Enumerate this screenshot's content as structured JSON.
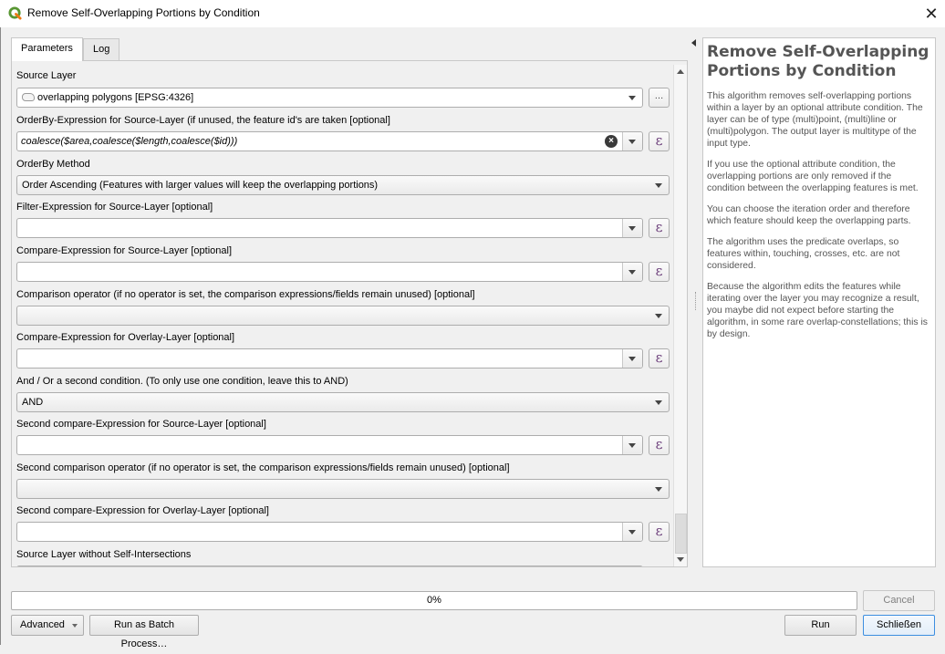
{
  "window": {
    "title": "Remove Self-Overlapping Portions by Condition",
    "close_glyph": "✕",
    "app_icon": "qgis-icon"
  },
  "tabs": [
    {
      "label": "Parameters",
      "active": true
    },
    {
      "label": "Log",
      "active": false
    }
  ],
  "parameters": {
    "source_layer": {
      "label": "Source Layer",
      "value": "overlapping polygons [EPSG:4326]",
      "icon": "polygon-layer-icon",
      "browse_label": "…"
    },
    "orderby_expression": {
      "label": "OrderBy-Expression for Source-Layer (if unused, the feature id's are taken [optional]",
      "value": "coalesce($area,coalesce($length,coalesce($id)))"
    },
    "orderby_method": {
      "label": "OrderBy Method",
      "value": "Order Ascending (Features with larger values will keep the overlapping portions)"
    },
    "filter_expression": {
      "label": "Filter-Expression for Source-Layer [optional]",
      "value": ""
    },
    "compare_expression_source": {
      "label": "Compare-Expression for Source-Layer [optional]",
      "value": ""
    },
    "comparison_operator": {
      "label": "Comparison operator (if no operator is set, the comparison expressions/fields remain unused) [optional]",
      "value": ""
    },
    "compare_expression_overlay": {
      "label": "Compare-Expression for Overlay-Layer [optional]",
      "value": ""
    },
    "and_or": {
      "label": "And / Or a second condition. (To only use one condition, leave this to AND)",
      "value": "AND"
    },
    "second_compare_source": {
      "label": "Second compare-Expression for Source-Layer [optional]",
      "value": ""
    },
    "second_comparison_operator": {
      "label": "Second comparison operator (if no operator is set, the comparison expressions/fields remain unused) [optional]",
      "value": ""
    },
    "second_compare_overlay": {
      "label": "Second compare-Expression for Overlay-Layer [optional]",
      "value": ""
    },
    "output": {
      "label": "Source Layer without Self-Intersections"
    },
    "expression_button_glyph": "ε"
  },
  "help": {
    "title": "Remove Self-Overlapping Portions by Condition",
    "paragraphs": [
      "This algorithm removes self-overlapping portions within a layer by an optional attribute condition. The layer can be of type (multi)point, (multi)line or (multi)polygon. The output layer is multitype of the input type.",
      "If you use the optional attribute condition, the overlapping portions are only removed if the condition between the overlapping features is met.",
      "You can choose the iteration order and therefore which feature should keep the overlapping parts.",
      "The algorithm uses the predicate overlaps, so features within, touching, crosses, etc. are not considered.",
      "Because the algorithm edits the features while iterating over the layer you may recognize a result, you maybe did not expect before starting the algorithm, in some rare overlap-constellations; this is by design."
    ]
  },
  "footer": {
    "progress_text": "0%",
    "progress_value": 0,
    "cancel_label": "Cancel",
    "advanced_label": "Advanced",
    "batch_label": "Run as Batch Process…",
    "run_label": "Run",
    "close_label": "Schließen"
  }
}
